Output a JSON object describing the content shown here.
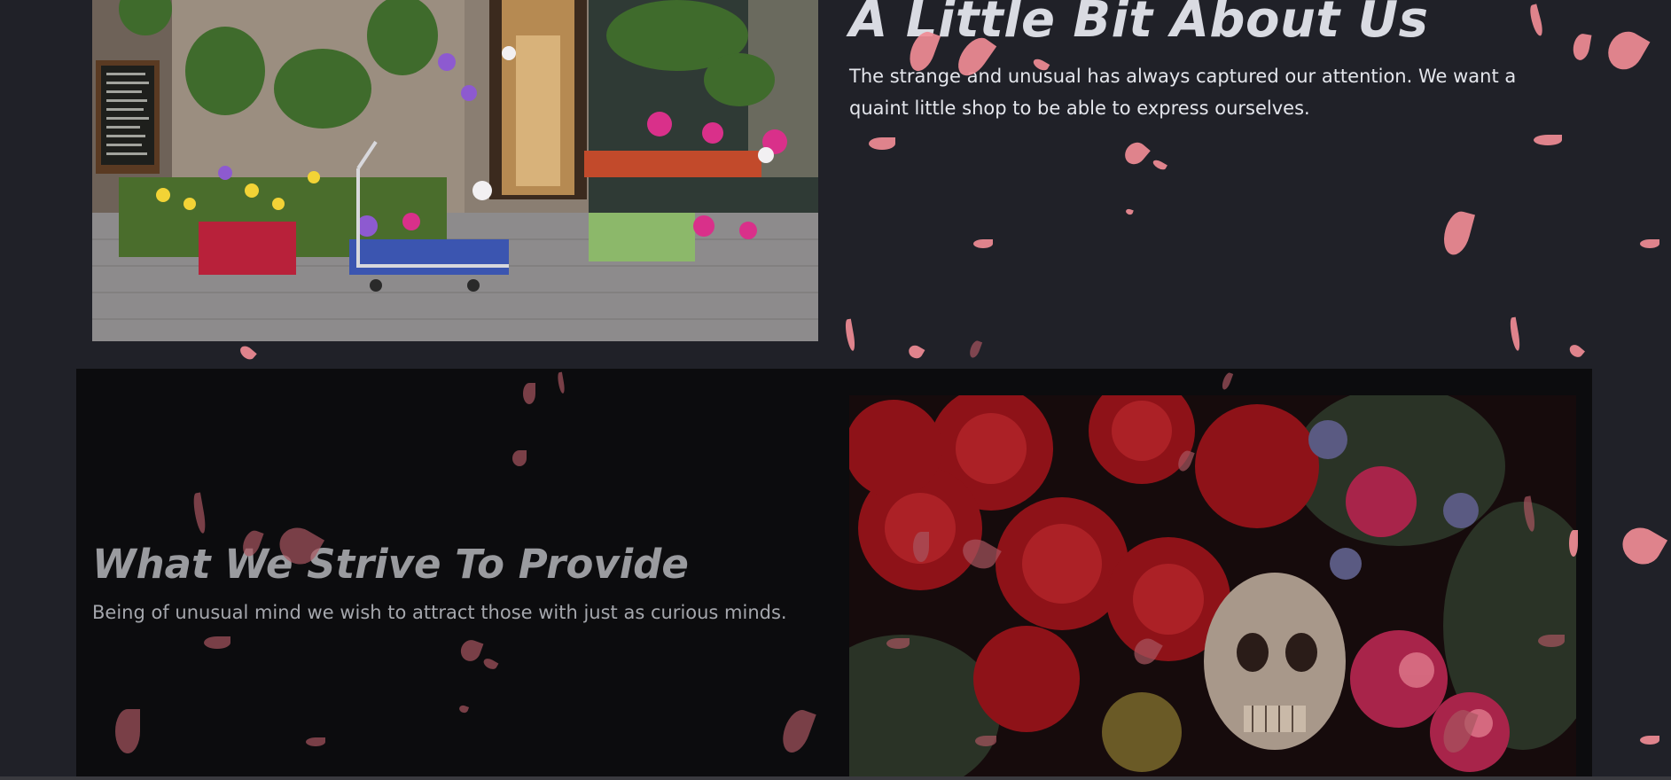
{
  "about": {
    "title": "A Little Bit About Us",
    "body": "The strange and unusual has always captured our attention. We want a quaint little shop to be able to express ourselves."
  },
  "provide": {
    "title": "What We Strive To Provide",
    "body": "Being of unusual mind we wish to attract those with just as curious minds."
  },
  "colors": {
    "page_background": "#202128",
    "band_background": "#0c0c0e",
    "petal": "#f08c95",
    "heading_light": "#d9dbe2",
    "heading_muted": "#9a9b9f"
  },
  "images": {
    "about_photo": "flower-shop-storefront-image",
    "provide_photo": "roses-and-skull-image"
  }
}
